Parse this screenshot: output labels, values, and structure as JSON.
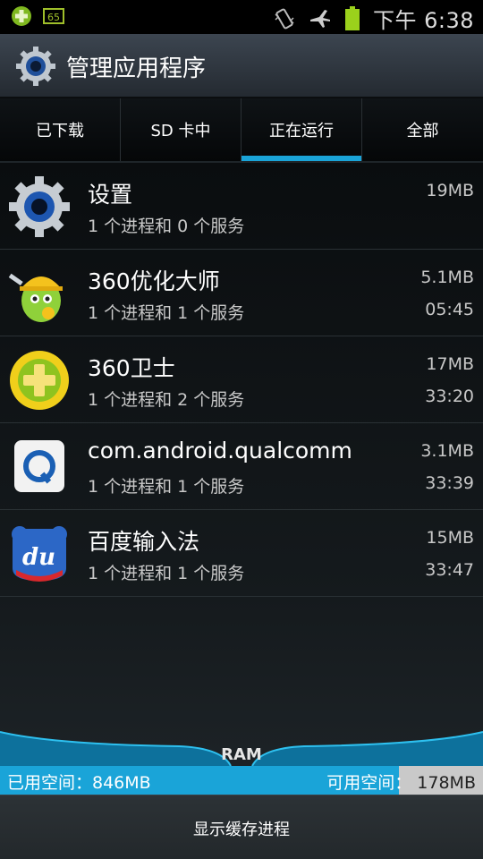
{
  "status_bar": {
    "time": "下午 6:38",
    "icons": [
      "360-notify-icon",
      "gprs-signal-icon",
      "vibrate-icon",
      "airplane-icon",
      "battery-icon"
    ],
    "gprs_label": "65"
  },
  "title_bar": {
    "title": "管理应用程序",
    "icon": "gear-icon"
  },
  "tabs": [
    {
      "label": "已下载",
      "active": false
    },
    {
      "label": "SD 卡中",
      "active": false
    },
    {
      "label": "正在运行",
      "active": true
    },
    {
      "label": "全部",
      "active": false
    }
  ],
  "apps": [
    {
      "name": "设置",
      "desc": "1 个进程和 0 个服务",
      "size": "19MB",
      "time": "",
      "icon": "settings-gear-icon"
    },
    {
      "name": "360优化大师",
      "desc": "1 个进程和 1 个服务",
      "size": "5.1MB",
      "time": "05:45",
      "icon": "360-optimizer-icon"
    },
    {
      "name": " 360卫士",
      "desc": "1 个进程和 2 个服务",
      "size": "17MB",
      "time": "33:20",
      "icon": "360-guard-icon"
    },
    {
      "name": "com.android.qualcomm",
      "desc": "1 个进程和 1 个服务",
      "size": "3.1MB",
      "time": "33:39",
      "icon": "qualcomm-icon"
    },
    {
      "name": "百度输入法",
      "desc": "1 个进程和 1 个服务",
      "size": "15MB",
      "time": "33:47",
      "icon": "baidu-input-icon"
    }
  ],
  "ram": {
    "label": "RAM",
    "used_label": "已用空间：846MB",
    "free_label": "可用空间：",
    "free_value": "178MB",
    "used_fraction": 0.826
  },
  "footer": {
    "show_cache_label": "显示缓存进程"
  },
  "colors": {
    "accent": "#1aa4d8",
    "free_fill": "#c9c9c9"
  }
}
